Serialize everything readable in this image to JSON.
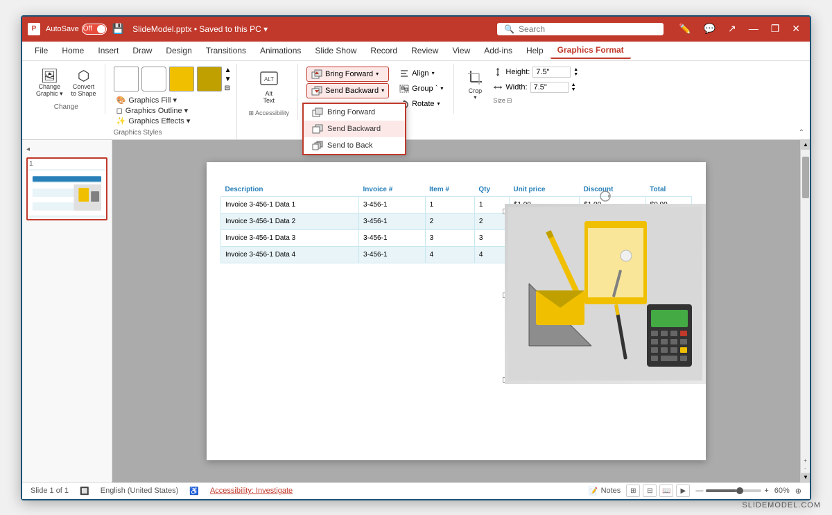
{
  "titlebar": {
    "logo": "P",
    "autosave_label": "AutoSave",
    "toggle_state": "Off",
    "filename": "SlideModel.pptx",
    "separator": "•",
    "save_status": "Saved to this PC",
    "dropdown_arrow": "▾",
    "search_placeholder": "Search",
    "window_controls": [
      "—",
      "❐",
      "✕"
    ]
  },
  "menubar": {
    "items": [
      "File",
      "Home",
      "Insert",
      "Draw",
      "Design",
      "Transitions",
      "Animations",
      "Slide Show",
      "Record",
      "Review",
      "View",
      "Add-ins",
      "Help",
      "Graphics Format"
    ]
  },
  "ribbon": {
    "change_group": {
      "label": "Change",
      "change_btn": "Change\nGraphic",
      "convert_btn": "Convert\nto Shape"
    },
    "styles_group": {
      "label": "Graphics Styles",
      "fill_label": "Graphics Fill",
      "outline_label": "Graphics Outline",
      "effects_label": "Graphics Effects"
    },
    "accessibility_group": {
      "label": "Accessibility",
      "alt_text": "Alt\nText"
    },
    "arrange_group": {
      "label": "",
      "bring_forward": "Bring Forward",
      "send_backward": "Send Backward",
      "align": "Align",
      "group": "Group",
      "rotate": "Rotate",
      "dropdown": {
        "items": [
          "Bring Forward",
          "Send Backward",
          "Send to Back"
        ]
      }
    },
    "size_group": {
      "label": "Size",
      "crop_label": "Crop",
      "height_label": "Height:",
      "height_value": "7.5\"",
      "width_label": "Width:",
      "width_value": "7.5\""
    }
  },
  "slide": {
    "number": "1",
    "table": {
      "headers": [
        "Description",
        "Invoice #",
        "Item #",
        "Qty",
        "Unit price",
        "Discount",
        "Total"
      ],
      "rows": [
        [
          "Invoice 3-456-1 Data 1",
          "3-456-1",
          "1",
          "1",
          "$1.00",
          "$1.00",
          "$0.00"
        ],
        [
          "Invoice 3-456-1 Data 2",
          "3-456-1",
          "2",
          "2",
          "",
          "",
          ""
        ],
        [
          "Invoice 3-456-1 Data 3",
          "3-456-1",
          "3",
          "3",
          "",
          "",
          ""
        ],
        [
          "Invoice 3-456-1 Data 4",
          "3-456-1",
          "4",
          "4",
          "",
          "",
          ""
        ]
      ]
    }
  },
  "statusbar": {
    "slide_info": "Slide 1 of 1",
    "language": "English (United States)",
    "accessibility": "Accessibility: Investigate",
    "notes": "Notes",
    "zoom_pct": "60%"
  },
  "watermark": "SLIDEMODEL.COM"
}
